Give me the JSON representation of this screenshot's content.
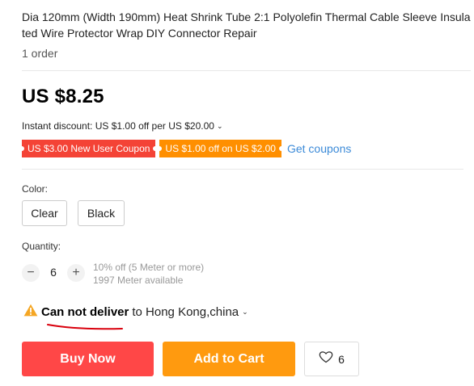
{
  "product": {
    "title": "Dia 120mm (Width 190mm) Heat Shrink Tube 2:1 Polyolefin Thermal Cable Sleeve Insulated Wire Protector Wrap DIY Connector Repair",
    "orders": "1 order",
    "price": "US $8.25",
    "instant_discount": "Instant discount: US $1.00 off per US $20.00"
  },
  "coupons": {
    "new_user": "US $3.00 New User Coupon",
    "spend": "US $1.00 off on US $2.00",
    "get_link": "Get coupons"
  },
  "color": {
    "label": "Color:",
    "options": [
      "Clear",
      "Black"
    ]
  },
  "quantity": {
    "label": "Quantity:",
    "value": "6",
    "minus": "−",
    "plus": "+",
    "discount_note": "10% off (5 Meter or more)",
    "available": "1997 Meter available"
  },
  "delivery": {
    "status": "Can not deliver",
    "destination": "to Hong Kong,china"
  },
  "actions": {
    "buy_now": "Buy Now",
    "add_to_cart": "Add to Cart",
    "wishlist_count": "6"
  },
  "colors": {
    "buy": "#ff4747",
    "cart": "#ff9a0f",
    "coupon_red": "#f44336",
    "coupon_orange": "#ff8f00",
    "link": "#3b8ad8",
    "warning": "#f5a623",
    "annotation": "#d9000d"
  },
  "icons": {
    "discount_chevron": "chevron-down-icon",
    "warning": "warning-icon",
    "wishlist": "heart-icon"
  }
}
